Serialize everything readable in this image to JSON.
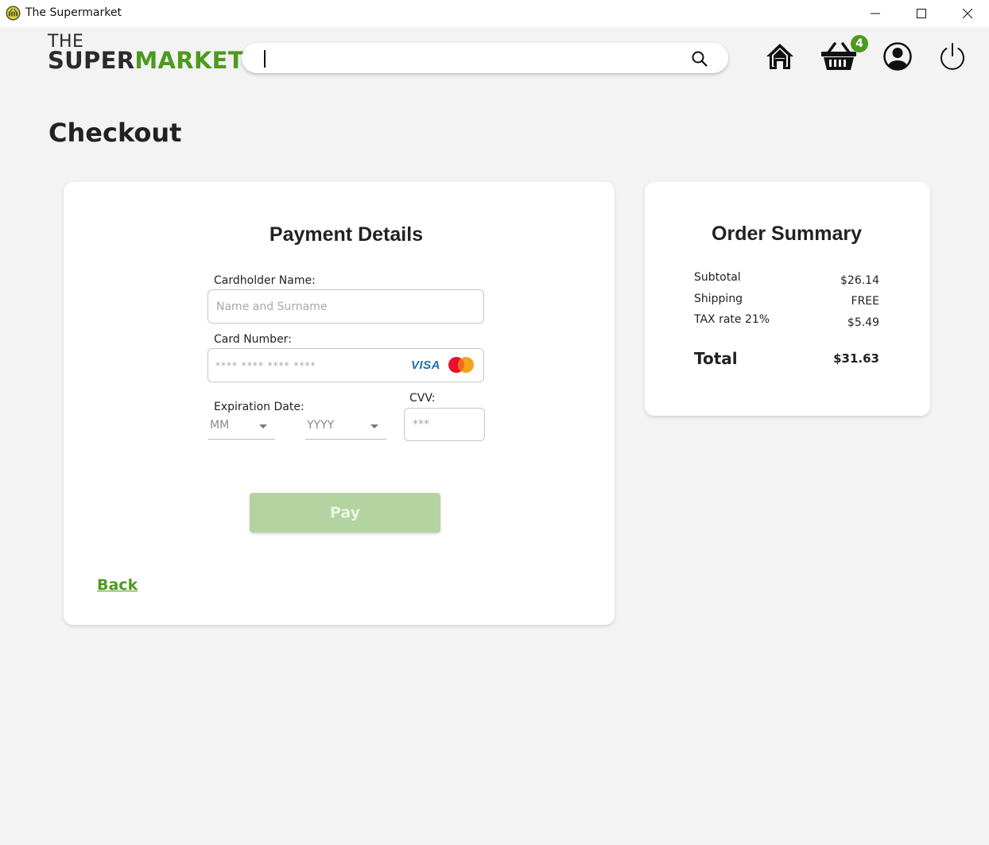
{
  "window": {
    "title": "The Supermarket"
  },
  "logo": {
    "line1": "THE",
    "line2_dark": "SUPER",
    "line2_green": "MARKET"
  },
  "search": {
    "value": "",
    "icon": "search-icon"
  },
  "nav": {
    "home_icon": "home-icon",
    "cart_icon": "basket-icon",
    "cart_count": "4",
    "profile_icon": "user-icon",
    "power_icon": "power-icon"
  },
  "page": {
    "title": "Checkout"
  },
  "payment": {
    "heading": "Payment Details",
    "cardholder_label": "Cardholder Name:",
    "cardholder_placeholder": "Name and Surname",
    "card_number_label": "Card Number:",
    "card_number_placeholder": "**** **** **** ****",
    "visa_label": "VISA",
    "expiration_label": "Expiration Date:",
    "month_value": "MM",
    "year_value": "YYYY",
    "cvv_label": "CVV:",
    "cvv_placeholder": "***",
    "pay_label": "Pay",
    "back_label": "Back"
  },
  "summary": {
    "heading": "Order Summary",
    "rows": [
      {
        "label": "Subtotal",
        "value": "$26.14"
      },
      {
        "label": "Shipping",
        "value": "FREE"
      },
      {
        "label": "TAX rate 21%",
        "value": "$5.49"
      }
    ],
    "total_label": "Total",
    "total_value": "$31.63"
  },
  "colors": {
    "brand_green": "#4d9a1e",
    "pay_disabled": "#b3d4a1",
    "background": "#f3f3f3"
  }
}
